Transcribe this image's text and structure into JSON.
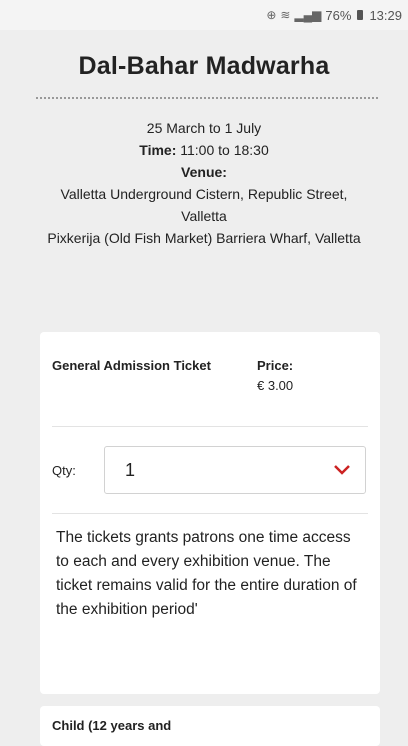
{
  "status_bar": {
    "location_icon": "location-icon",
    "wifi_icon": "wifi-icon",
    "signal_icon": "signal-icon",
    "battery_percent": "76%",
    "battery_icon": "battery-icon",
    "time": "13:29"
  },
  "header": {
    "title": "Dal-Bahar Madwarha"
  },
  "event": {
    "dates": "25 March to 1 July",
    "time_label": "Time:",
    "time_value": "11:00 to 18:30",
    "venue_label": "Venue:",
    "venue_line1": "Valletta Underground Cistern, Republic Street, Valletta",
    "venue_line2": "Pixkerija (Old Fish Market) Barriera Wharf, Valletta"
  },
  "tickets": [
    {
      "name": "General Admission Ticket",
      "price_label": "Price:",
      "price": "€ 3.00",
      "qty_label": "Qty:",
      "qty_value": "1",
      "description": "The tickets grants patrons one time access to each and every exhibition venue. The ticket remains valid for the entire duration of the exhibition period'"
    },
    {
      "name": "Child (12 years and"
    }
  ],
  "colors": {
    "accent": "#cc2222",
    "background": "#eeeeee",
    "card": "#ffffff"
  }
}
